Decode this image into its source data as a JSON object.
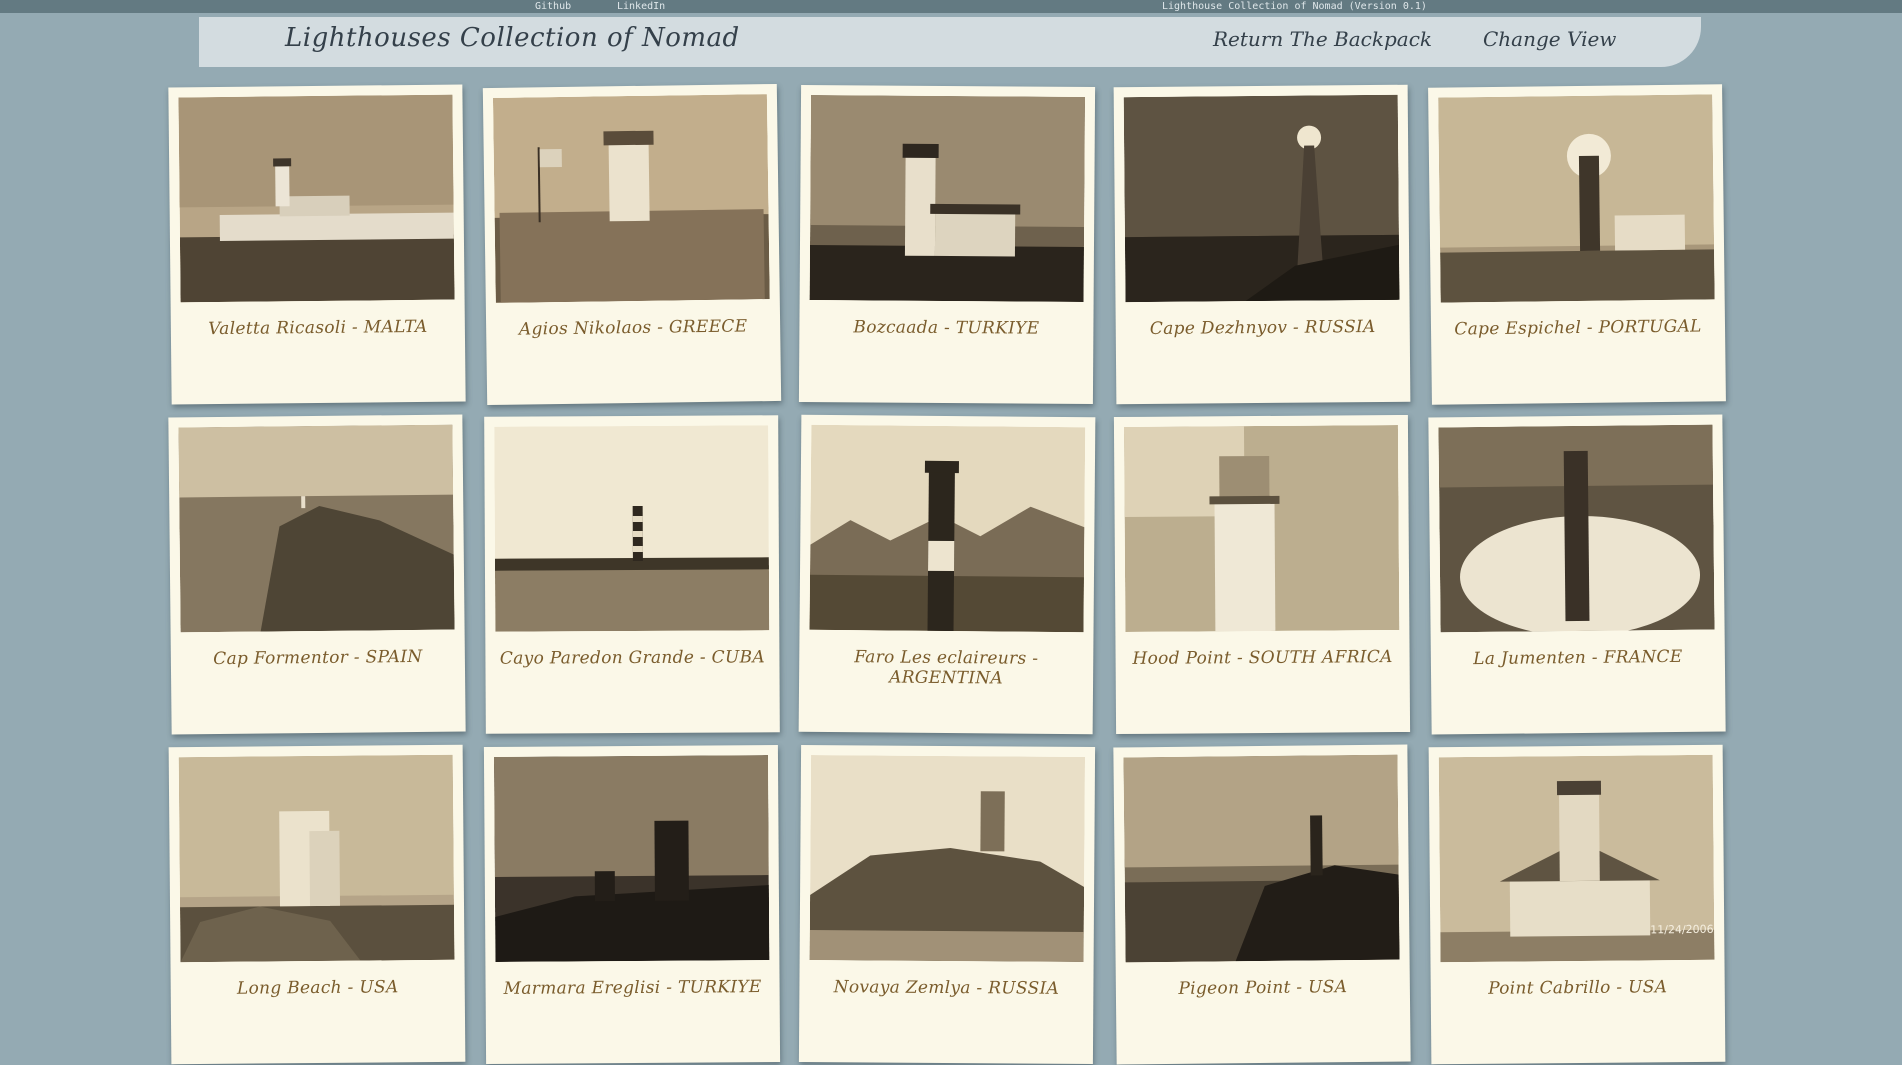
{
  "topbar": {
    "github": "Github",
    "linkedin": "LinkedIn",
    "version": "Lighthouse Collection of Nomad (Version 0.1)"
  },
  "header": {
    "title": "Lighthouses Collection of Nomad",
    "nav_backpack": "Return The Backpack",
    "nav_view": "Change View"
  },
  "cards": [
    {
      "caption": "Valetta Ricasoli - MALTA"
    },
    {
      "caption": "Agios Nikolaos - GREECE"
    },
    {
      "caption": "Bozcaada - TURKIYE"
    },
    {
      "caption": "Cape Dezhnyov - RUSSIA"
    },
    {
      "caption": "Cape Espichel - PORTUGAL"
    },
    {
      "caption": "Cap Formentor - SPAIN"
    },
    {
      "caption": "Cayo Paredon Grande - CUBA"
    },
    {
      "caption": "Faro Les eclaireurs - ARGENTINA"
    },
    {
      "caption": "Hood Point - SOUTH AFRICA"
    },
    {
      "caption": "La Jumenten - FRANCE"
    },
    {
      "caption": "Long Beach - USA"
    },
    {
      "caption": "Marmara Ereglisi - TURKIYE"
    },
    {
      "caption": "Novaya Zemlya - RUSSIA"
    },
    {
      "caption": "Pigeon Point - USA"
    },
    {
      "caption": "Point Cabrillo - USA",
      "photo_stamp": "11/24/2006"
    }
  ],
  "colors": {
    "background": "#94aab3",
    "card": "#fbf8e8",
    "caption": "#7a5c2c",
    "header": "#d3dce0"
  }
}
